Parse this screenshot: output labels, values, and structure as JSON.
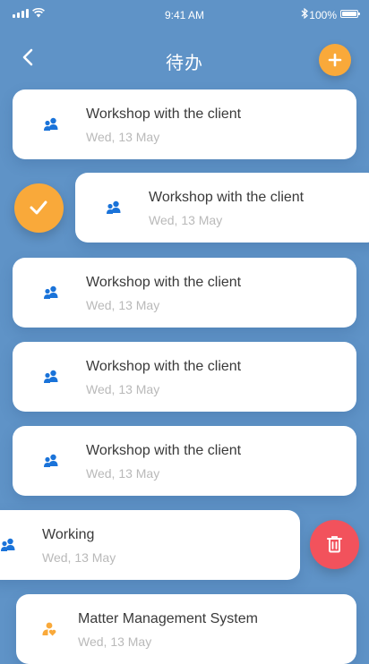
{
  "status_bar": {
    "time": "9:41 AM",
    "battery": "100%"
  },
  "header": {
    "title": "待办"
  },
  "colors": {
    "background": "#5f93c7",
    "accent_orange": "#f9a93a",
    "delete_red": "#f2525c",
    "icon_blue": "#1a73d9"
  },
  "items": [
    {
      "title": "Workshop with the client",
      "date": "Wed, 13 May",
      "icon": "users-icon"
    },
    {
      "title": "Workshop with the client",
      "date": "Wed, 13 May",
      "icon": "users-icon",
      "state": "swiped-right"
    },
    {
      "title": "Workshop with the client",
      "date": "Wed, 13 May",
      "icon": "users-icon"
    },
    {
      "title": "Workshop with the client",
      "date": "Wed, 13 May",
      "icon": "users-icon"
    },
    {
      "title": "Workshop with the client",
      "date": "Wed, 13 May",
      "icon": "users-icon"
    },
    {
      "title": "Working",
      "date": "Wed, 13 May",
      "icon": "users-icon",
      "state": "swiped-left"
    },
    {
      "title": "Matter Management System",
      "date": "Wed, 13 May",
      "icon": "user-heart-icon"
    }
  ]
}
